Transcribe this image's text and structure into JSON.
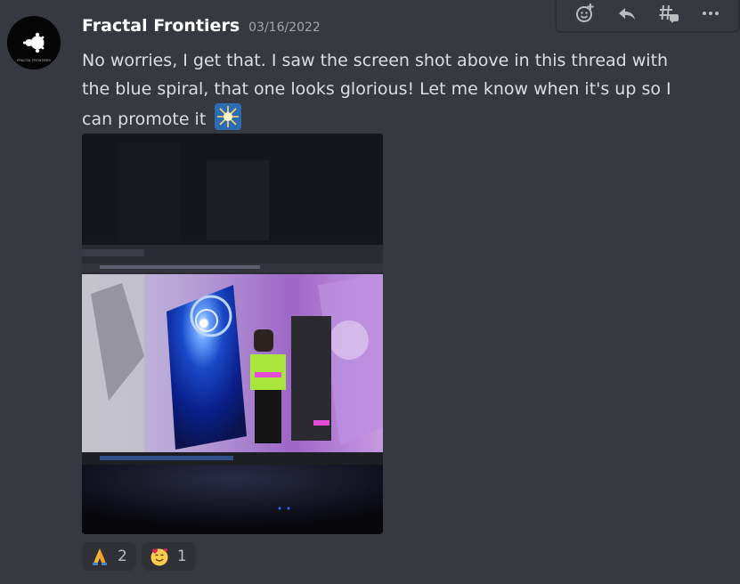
{
  "message": {
    "author": "Fractal Frontiers",
    "timestamp": "03/16/2022",
    "text": "No worries, I get that. I saw the screen shot above in this thread with the blue spiral, that one looks glorious! Let me know when it's up so I can promote it",
    "avatar_text": "FRACTAL FRONTIERS",
    "inline_emoji": "sparkle-star-emoji"
  },
  "reactions": [
    {
      "emoji": "folded-hands-emoji",
      "count": "2"
    },
    {
      "emoji": "smiling-face-with-hearts-emoji",
      "count": "1"
    }
  ],
  "toolbar": {
    "icons": [
      "add-reaction-icon",
      "reply-icon",
      "create-thread-icon",
      "more-options-icon"
    ]
  },
  "colors": {
    "background": "#36393f",
    "username": "#ffffff",
    "text": "#dcddde",
    "timestamp": "#a3a6aa",
    "reaction_bg": "#2f3136"
  }
}
